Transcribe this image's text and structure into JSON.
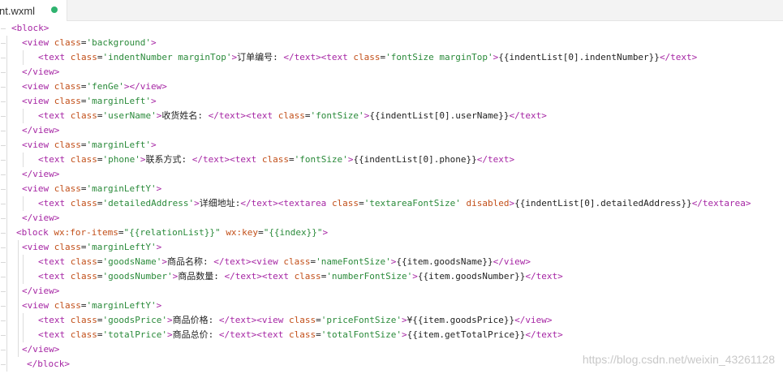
{
  "tab": {
    "label": "nt.wxml",
    "unsaved_color": "#2fb36f"
  },
  "colors": {
    "tag": "#a626a4",
    "attr": "#c24f19",
    "string": "#2a8a3a",
    "text": "#222222",
    "guide": "#dcdcdc"
  },
  "code_lines": [
    [
      [
        "t",
        "<block>"
      ]
    ],
    [
      [
        "t",
        "<view "
      ],
      [
        "a",
        "class"
      ],
      [
        "p",
        "="
      ],
      [
        "s",
        "'background'"
      ],
      [
        "t",
        ">"
      ]
    ],
    [
      [
        "t",
        "<text "
      ],
      [
        "a",
        "class"
      ],
      [
        "p",
        "="
      ],
      [
        "s",
        "'indentNumber marginTop'"
      ],
      [
        "t",
        ">"
      ],
      [
        "x",
        "订单编号: "
      ],
      [
        "t",
        "</text><text "
      ],
      [
        "a",
        "class"
      ],
      [
        "p",
        "="
      ],
      [
        "s",
        "'fontSize marginTop'"
      ],
      [
        "t",
        ">"
      ],
      [
        "x",
        "{{indentList[0].indentNumber}}"
      ],
      [
        "t",
        "</text>"
      ]
    ],
    [
      [
        "t",
        "</view>"
      ]
    ],
    [
      [
        "t",
        "<view "
      ],
      [
        "a",
        "class"
      ],
      [
        "p",
        "="
      ],
      [
        "s",
        "'fenGe'"
      ],
      [
        "t",
        "></view>"
      ]
    ],
    [
      [
        "t",
        "<view "
      ],
      [
        "a",
        "class"
      ],
      [
        "p",
        "="
      ],
      [
        "s",
        "'marginLeft'"
      ],
      [
        "t",
        ">"
      ]
    ],
    [
      [
        "t",
        "<text "
      ],
      [
        "a",
        "class"
      ],
      [
        "p",
        "="
      ],
      [
        "s",
        "'userName'"
      ],
      [
        "t",
        ">"
      ],
      [
        "x",
        "收货姓名: "
      ],
      [
        "t",
        "</text><text "
      ],
      [
        "a",
        "class"
      ],
      [
        "p",
        "="
      ],
      [
        "s",
        "'fontSize'"
      ],
      [
        "t",
        ">"
      ],
      [
        "x",
        "{{indentList[0].userName}}"
      ],
      [
        "t",
        "</text>"
      ]
    ],
    [
      [
        "t",
        "</view>"
      ]
    ],
    [
      [
        "t",
        "<view "
      ],
      [
        "a",
        "class"
      ],
      [
        "p",
        "="
      ],
      [
        "s",
        "'marginLeft'"
      ],
      [
        "t",
        ">"
      ]
    ],
    [
      [
        "t",
        "<text "
      ],
      [
        "a",
        "class"
      ],
      [
        "p",
        "="
      ],
      [
        "s",
        "'phone'"
      ],
      [
        "t",
        ">"
      ],
      [
        "x",
        "联系方式: "
      ],
      [
        "t",
        "</text><text "
      ],
      [
        "a",
        "class"
      ],
      [
        "p",
        "="
      ],
      [
        "s",
        "'fontSize'"
      ],
      [
        "t",
        ">"
      ],
      [
        "x",
        "{{indentList[0].phone}}"
      ],
      [
        "t",
        "</text>"
      ]
    ],
    [
      [
        "t",
        "</view>"
      ]
    ],
    [
      [
        "t",
        "<view "
      ],
      [
        "a",
        "class"
      ],
      [
        "p",
        "="
      ],
      [
        "s",
        "'marginLeftY'"
      ],
      [
        "t",
        ">"
      ]
    ],
    [
      [
        "t",
        "<text "
      ],
      [
        "a",
        "class"
      ],
      [
        "p",
        "="
      ],
      [
        "s",
        "'detailedAddress'"
      ],
      [
        "t",
        ">"
      ],
      [
        "x",
        "详细地址:"
      ],
      [
        "t",
        "</text><textarea "
      ],
      [
        "a",
        "class"
      ],
      [
        "p",
        "="
      ],
      [
        "s",
        "'textareaFontSize'"
      ],
      [
        "x",
        " "
      ],
      [
        "a",
        "disabled"
      ],
      [
        "t",
        ">"
      ],
      [
        "x",
        "{{indentList[0].detailedAddress}}"
      ],
      [
        "t",
        "</textarea>"
      ]
    ],
    [
      [
        "t",
        "</view>"
      ]
    ],
    [
      [
        "t",
        "<block "
      ],
      [
        "a",
        "wx:for-items"
      ],
      [
        "p",
        "="
      ],
      [
        "s",
        "\"{{relationList}}\""
      ],
      [
        "x",
        " "
      ],
      [
        "a",
        "wx:key"
      ],
      [
        "p",
        "="
      ],
      [
        "s",
        "\"{{index}}\""
      ],
      [
        "t",
        ">"
      ]
    ],
    [
      [
        "t",
        "<view "
      ],
      [
        "a",
        "class"
      ],
      [
        "p",
        "="
      ],
      [
        "s",
        "'marginLeftY'"
      ],
      [
        "t",
        ">"
      ]
    ],
    [
      [
        "t",
        "<text "
      ],
      [
        "a",
        "class"
      ],
      [
        "p",
        "="
      ],
      [
        "s",
        "'goodsName'"
      ],
      [
        "t",
        ">"
      ],
      [
        "x",
        "商品名称: "
      ],
      [
        "t",
        "</text><view "
      ],
      [
        "a",
        "class"
      ],
      [
        "p",
        "="
      ],
      [
        "s",
        "'nameFontSize'"
      ],
      [
        "t",
        ">"
      ],
      [
        "x",
        "{{item.goodsName}}"
      ],
      [
        "t",
        "</view>"
      ]
    ],
    [
      [
        "t",
        "<text "
      ],
      [
        "a",
        "class"
      ],
      [
        "p",
        "="
      ],
      [
        "s",
        "'goodsNumber'"
      ],
      [
        "t",
        ">"
      ],
      [
        "x",
        "商品数量: "
      ],
      [
        "t",
        "</text><text "
      ],
      [
        "a",
        "class"
      ],
      [
        "p",
        "="
      ],
      [
        "s",
        "'numberFontSize'"
      ],
      [
        "t",
        ">"
      ],
      [
        "x",
        "{{item.goodsNumber}}"
      ],
      [
        "t",
        "</text>"
      ]
    ],
    [
      [
        "t",
        "</view>"
      ]
    ],
    [
      [
        "t",
        "<view "
      ],
      [
        "a",
        "class"
      ],
      [
        "p",
        "="
      ],
      [
        "s",
        "'marginLeftY'"
      ],
      [
        "t",
        ">"
      ]
    ],
    [
      [
        "t",
        "<text "
      ],
      [
        "a",
        "class"
      ],
      [
        "p",
        "="
      ],
      [
        "s",
        "'goodsPrice'"
      ],
      [
        "t",
        ">"
      ],
      [
        "x",
        "商品价格: "
      ],
      [
        "t",
        "</text><view "
      ],
      [
        "a",
        "class"
      ],
      [
        "p",
        "="
      ],
      [
        "s",
        "'priceFontSize'"
      ],
      [
        "t",
        ">"
      ],
      [
        "x",
        "¥{{item.goodsPrice}}"
      ],
      [
        "t",
        "</view>"
      ]
    ],
    [
      [
        "t",
        "<text "
      ],
      [
        "a",
        "class"
      ],
      [
        "p",
        "="
      ],
      [
        "s",
        "'totalPrice'"
      ],
      [
        "t",
        ">"
      ],
      [
        "x",
        "商品总价: "
      ],
      [
        "t",
        "</text><text "
      ],
      [
        "a",
        "class"
      ],
      [
        "p",
        "="
      ],
      [
        "s",
        "'totalFontSize'"
      ],
      [
        "t",
        ">"
      ],
      [
        "x",
        "{{item.getTotalPrice}}"
      ],
      [
        "t",
        "</text>"
      ]
    ],
    [
      [
        "t",
        "</view>"
      ]
    ],
    [
      [
        "t",
        "</block>"
      ]
    ]
  ],
  "watermark": "https://blog.csdn.net/weixin_43261128"
}
